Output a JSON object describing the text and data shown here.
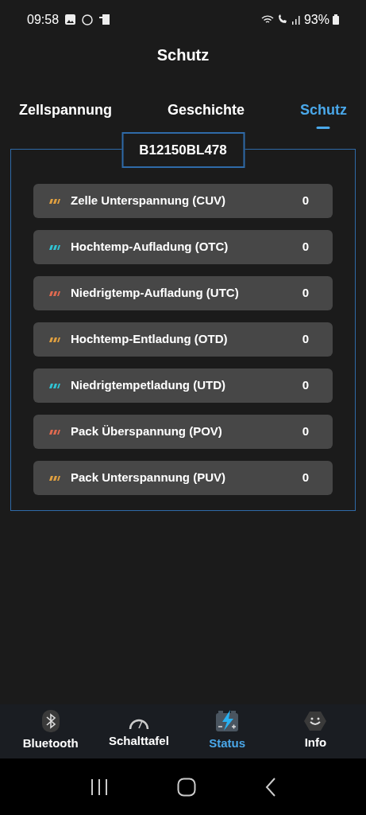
{
  "status_bar": {
    "time": "09:58",
    "battery": "93%"
  },
  "title": "Schutz",
  "tabs": [
    {
      "label": "Zellspannung",
      "selected": false
    },
    {
      "label": "Geschichte",
      "selected": false
    },
    {
      "label": "Schutz",
      "selected": true
    }
  ],
  "device_id": "B12150BL478",
  "protections": [
    {
      "label": "Zelle Unterspannung (CUV)",
      "count": "0",
      "color": "#e0a040"
    },
    {
      "label": "Hochtemp-Aufladung (OTC)",
      "count": "0",
      "color": "#30c4d4"
    },
    {
      "label": "Niedrigtemp-Aufladung (UTC)",
      "count": "0",
      "color": "#e06a50"
    },
    {
      "label": "Hochtemp-Entladung (OTD)",
      "count": "0",
      "color": "#e0a040"
    },
    {
      "label": "Niedrigtempetladung (UTD)",
      "count": "0",
      "color": "#30c4d4"
    },
    {
      "label": "Pack Überspannung (POV)",
      "count": "0",
      "color": "#e06a50"
    },
    {
      "label": "Pack Unterspannung (PUV)",
      "count": "0",
      "color": "#e0a040"
    }
  ],
  "bottom_nav": [
    {
      "label": "Bluetooth",
      "kind": "bluetooth",
      "selected": false
    },
    {
      "label": "Schalttafel",
      "kind": "gauge",
      "selected": false
    },
    {
      "label": "Status",
      "kind": "battery",
      "selected": true
    },
    {
      "label": "Info",
      "kind": "smiley",
      "selected": false
    }
  ]
}
